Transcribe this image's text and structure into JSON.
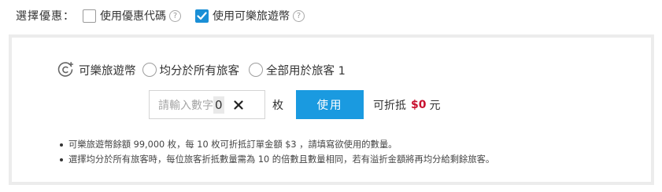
{
  "selection": {
    "label": "選擇優惠：",
    "options": [
      {
        "label": "使用優惠代碼",
        "checked": false,
        "help_icon": "question-circle-icon"
      },
      {
        "label": "使用可樂旅遊幣",
        "checked": true,
        "help_icon": "question-circle-icon"
      }
    ],
    "help_glyph": "?"
  },
  "coin_panel": {
    "icon": "coin-plus-icon",
    "title": "可樂旅遊幣",
    "mode_options": [
      {
        "label": "均分於所有旅客",
        "selected": false
      },
      {
        "label": "全部用於旅客 1",
        "selected": false
      }
    ],
    "quantity": {
      "placeholder": "請輸入數字",
      "value": "0",
      "unit": "枚",
      "clear_icon": "close-icon"
    },
    "use_button": "使用",
    "deduct_label": "可折抵",
    "deduct_amount": "$0",
    "deduct_unit": "元",
    "notes": [
      "可樂旅遊幣餘額 99,000 枚，每 10 枚可折抵訂單金額 $3 ，請填寫欲使用的數量。",
      "選擇均分於所有旅客時，每位旅客折抵數量需為 10 的倍數且數量相同，若有溢折金額將再均分給剩餘旅客。"
    ]
  },
  "colors": {
    "accent": "#1a9ae0",
    "checkbox_checked": "#1a8fd6",
    "price": "#c8102e",
    "panel_border": "#ececec"
  }
}
